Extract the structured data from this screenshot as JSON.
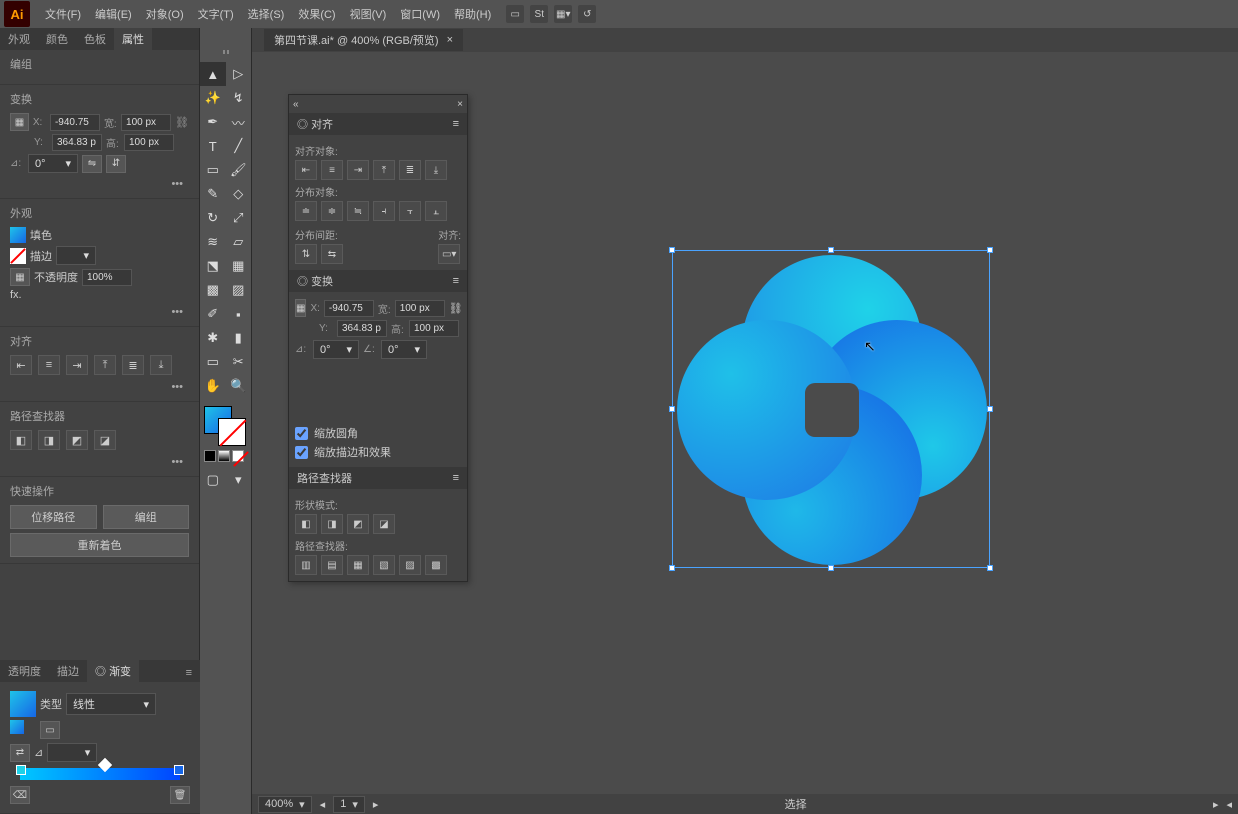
{
  "app": {
    "name": "Ai"
  },
  "menus": [
    "文件(F)",
    "编辑(E)",
    "对象(O)",
    "文字(T)",
    "选择(S)",
    "效果(C)",
    "视图(V)",
    "窗口(W)",
    "帮助(H)"
  ],
  "document": {
    "tab_title": "第四节课.ai* @ 400% (RGB/预览)",
    "close_x": "×"
  },
  "left": {
    "tabs": [
      "外观",
      "颜色",
      "色板",
      "属性"
    ],
    "active_tab": 3,
    "sec_group": "编组",
    "sec_transform": "变换",
    "x_label": "X:",
    "x_val": "-940.75",
    "y_label": "Y:",
    "y_val": "364.83 p",
    "w_label": "宽:",
    "w_val": "100 px",
    "h_label": "高:",
    "h_val": "100 px",
    "angle_label": "⊿:",
    "angle_val": "0°",
    "sec_appearance": "外观",
    "fill_label": "填色",
    "stroke_label": "描边",
    "stroke_weight": "",
    "opacity_label": "不透明度",
    "opacity_val": "100%",
    "fx": "fx.",
    "sec_align_title": "对齐",
    "sec_pathfinder_title": "路径查找器",
    "sec_quick": "快速操作",
    "btn_offset_path": "位移路径",
    "btn_ungroup": "编组",
    "btn_recolor": "重新着色",
    "dots": "•••"
  },
  "bottom_panel": {
    "tabs": [
      "透明度",
      "描边",
      "渐变"
    ],
    "type_label": "类型",
    "type_val": "线性",
    "angle_label": "⊿",
    "angle_val": ""
  },
  "float": {
    "align_tab": "对齐",
    "lbl_align_objects": "对齐对象:",
    "lbl_distribute_objects": "分布对象:",
    "lbl_distribute_spacing": "分布间距:",
    "lbl_align_to": "对齐:",
    "transform_tab": "变换",
    "t_x_label": "X:",
    "t_x_val": "-940.75",
    "t_w_label": "宽:",
    "t_w_val": "100 px",
    "t_y_label": "Y:",
    "t_y_val": "364.83 p",
    "t_h_label": "高:",
    "t_h_val": "100 px",
    "t_angle_label": "⊿:",
    "t_angle_val": "0°",
    "t_shear_label": "∠:",
    "t_shear_val": "0°",
    "chk_scale_corners": "缩放圆角",
    "chk_scale_strokes": "缩放描边和效果",
    "pathfinder_tab": "路径查找器",
    "lbl_shape_modes": "形状模式:",
    "lbl_pathfinders": "路径查找器:"
  },
  "status": {
    "zoom": "400%",
    "page": "1",
    "tool_hint": "选择"
  },
  "colors": {
    "grad_start": "#1fd2e8",
    "grad_end": "#1666e6"
  }
}
